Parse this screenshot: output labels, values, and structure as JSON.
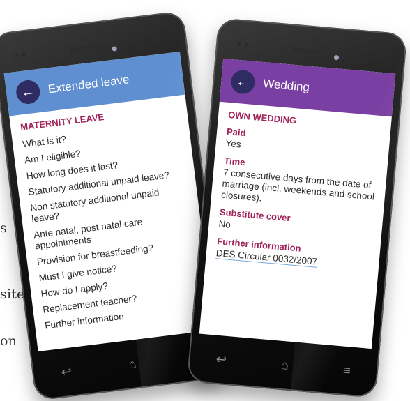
{
  "background_fragments": [
    "s",
    "sites",
    "on"
  ],
  "phones": [
    {
      "appbar": {
        "back_icon": "arrow-left-icon",
        "title": "Extended leave",
        "color": "#5f8fd0"
      },
      "section_title": "MATERNITY LEAVE",
      "menu_items": [
        "What is it?",
        "Am I eligible?",
        "How long does it last?",
        "Statutory additional unpaid leave?",
        "Non statutory additional unpaid leave?",
        "Ante natal, post natal care appointments",
        "Provision for breastfeeding?",
        "Must I give notice?",
        "How do I apply?",
        "Replacement teacher?",
        "Further information"
      ],
      "nav": {
        "back": "↩",
        "home": "⌂"
      }
    },
    {
      "appbar": {
        "back_icon": "arrow-left-icon",
        "title": "Wedding",
        "color": "#7a3fa2"
      },
      "section_title": "OWN WEDDING",
      "fields": [
        {
          "label": "Paid",
          "value": "Yes"
        },
        {
          "label": "Time",
          "value": "7 consecutive days from the date of marriage (incl. weekends and school closures)."
        },
        {
          "label": "Substitute cover",
          "value": "No"
        }
      ],
      "further_info": {
        "label": "Further information",
        "link": "DES Circular 0032/2007"
      },
      "nav": {
        "back": "↩",
        "home": "⌂",
        "menu": "≡"
      }
    }
  ],
  "colors": {
    "label_accent": "#a0245a",
    "back_button": "#2e2c62"
  }
}
